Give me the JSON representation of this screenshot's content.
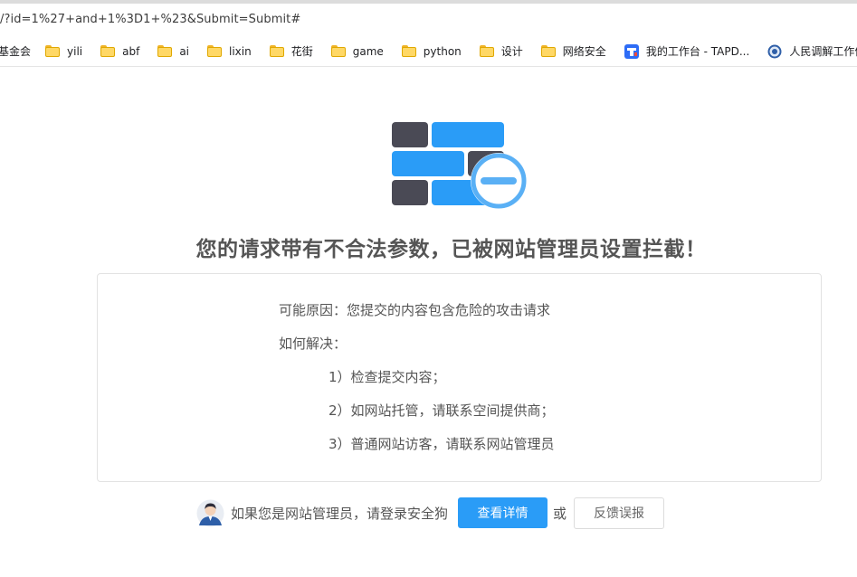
{
  "browser": {
    "url_text": "/?id=1%27+and+1%3D1+%23&Submit=Submit#",
    "bookmarks": [
      {
        "label": "基金会",
        "icon": "none"
      },
      {
        "label": "yili",
        "icon": "folder-icon"
      },
      {
        "label": "abf",
        "icon": "folder-icon"
      },
      {
        "label": "ai",
        "icon": "folder-icon"
      },
      {
        "label": "lixin",
        "icon": "folder-icon"
      },
      {
        "label": "花街",
        "icon": "folder-icon"
      },
      {
        "label": "game",
        "icon": "folder-icon"
      },
      {
        "label": "python",
        "icon": "folder-icon"
      },
      {
        "label": "设计",
        "icon": "folder-icon"
      },
      {
        "label": "网络安全",
        "icon": "folder-icon"
      },
      {
        "label": "我的工作台 - TAPD...",
        "icon": "tapd-icon"
      },
      {
        "label": "人民调解工作信息...",
        "icon": "emblem-icon"
      }
    ]
  },
  "block_page": {
    "logo_icon": "firewall-block-icon",
    "title": "您的请求带有不合法参数，已被网站管理员设置拦截！",
    "reason": "可能原因：您提交的内容包含危险的攻击请求",
    "how_to_resolve": "如何解决：",
    "steps": [
      "1）检查提交内容；",
      "2）如网站托管，请联系空间提供商；",
      "3）普通网站访客，请联系网站管理员"
    ],
    "footer": {
      "avatar_icon": "admin-avatar-icon",
      "admin_prompt": "如果您是网站管理员，请登录安全狗",
      "details_button": "查看详情",
      "or_text": "或",
      "report_button": "反馈误报"
    }
  },
  "colors": {
    "brick_dark": "#4a4a55",
    "brick_blue": "#2a9cf7",
    "minus_circle": "#5ab0f5",
    "button_primary": "#2a9cf7",
    "title_text": "#555555"
  }
}
